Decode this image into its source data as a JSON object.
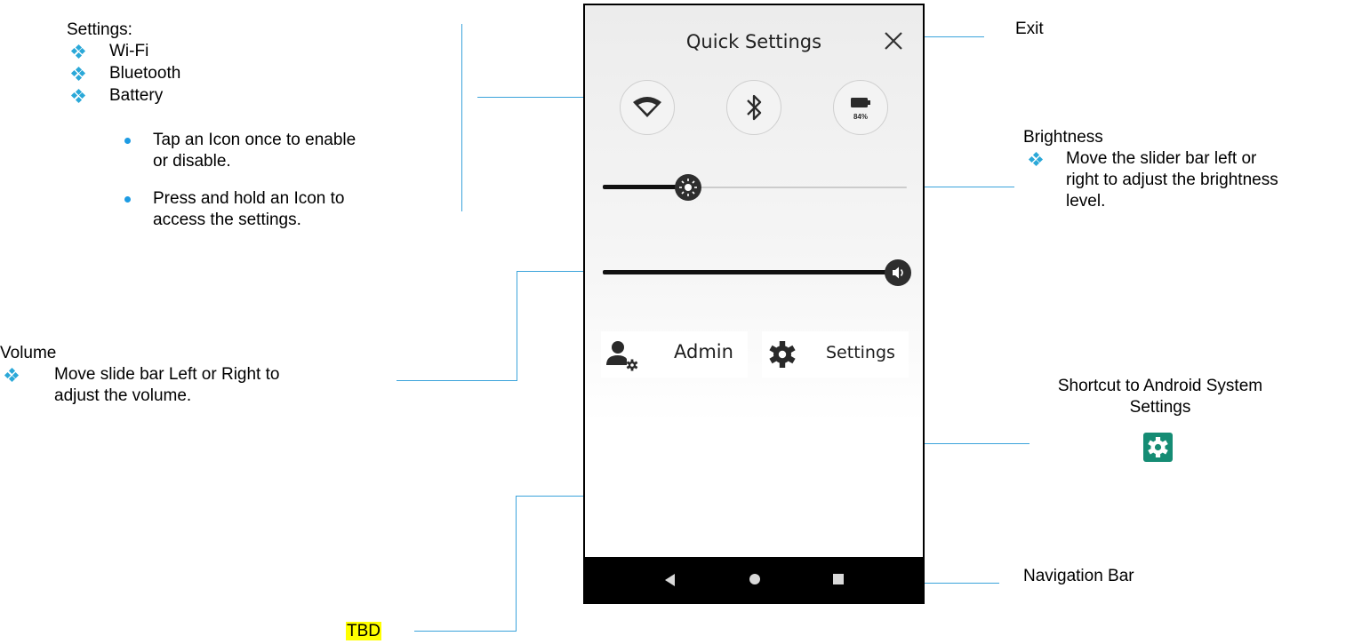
{
  "phone": {
    "title": "Quick Settings",
    "battery_percent": "84%",
    "brightness_level": 0.28,
    "volume_level": 0.97,
    "tiles": {
      "admin_label": "Admin",
      "settings_label": "Settings"
    },
    "nav_buttons": [
      "back",
      "home",
      "recents"
    ]
  },
  "annotations": {
    "settings_block": {
      "heading": "Settings:",
      "items": [
        "Wi-Fi",
        "Bluetooth",
        "Battery"
      ],
      "sub_items": [
        [
          "Tap an Icon once to enable",
          "or disable."
        ],
        [
          "Press and hold an Icon to",
          "access the settings."
        ]
      ]
    },
    "exit": "Exit",
    "brightness": {
      "heading": "Brightness",
      "lines": [
        "Move the slider bar left or",
        "right to adjust the brightness",
        "level."
      ]
    },
    "volume": {
      "heading": "Volume",
      "lines": [
        "Move slide bar Left or Right to",
        "adjust the volume."
      ]
    },
    "shortcut": {
      "lines": [
        "Shortcut to Android System",
        "Settings"
      ]
    },
    "navigation_bar": "Navigation Bar",
    "tbd": "TBD"
  },
  "colors": {
    "callout_line": "#3aa3db",
    "bullet": "#2aa8d8",
    "settings_badge": "#158c74",
    "tbd_highlight": "#ffff00"
  }
}
